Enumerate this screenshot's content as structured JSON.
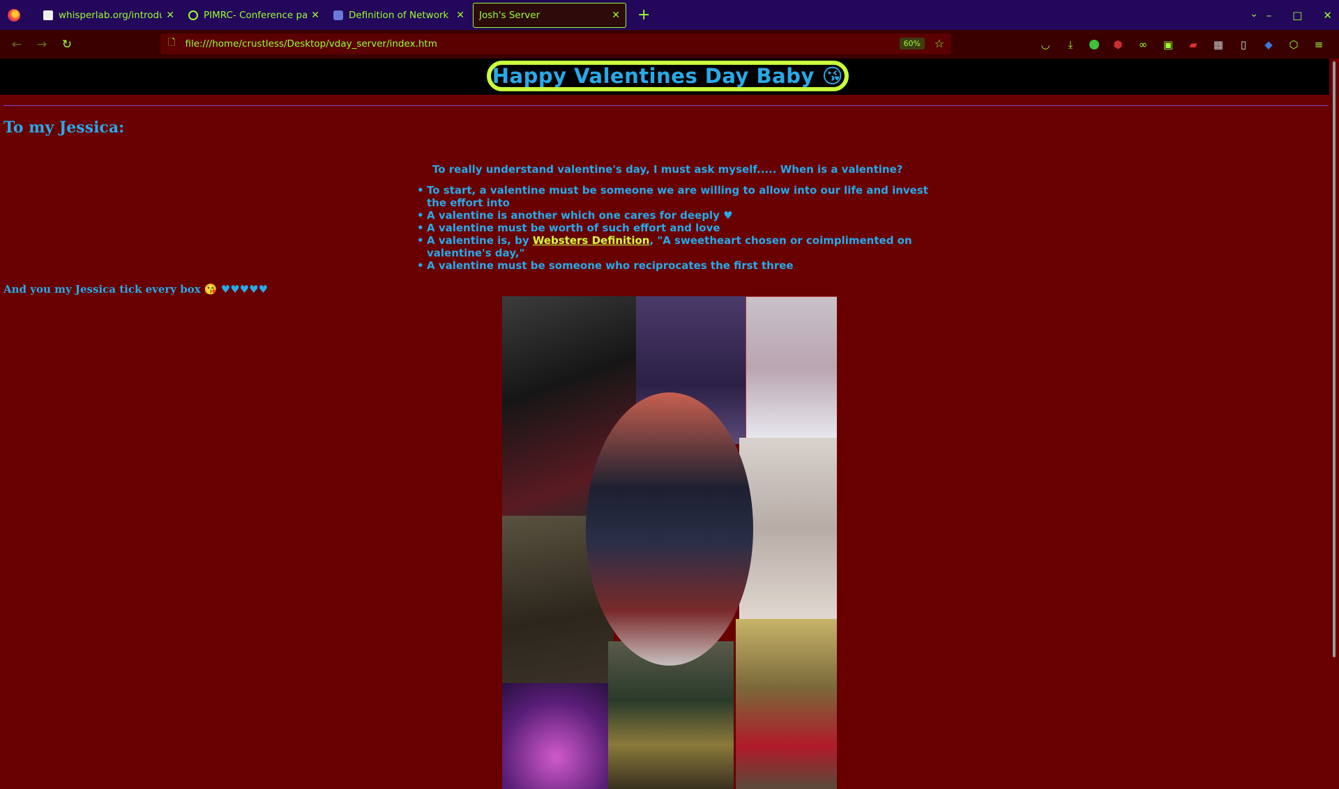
{
  "browser": {
    "tabs": [
      {
        "title": "whisperlab.org/introductio",
        "icon": "page-favicon",
        "active": false
      },
      {
        "title": "PIMRC- Conference paper - ",
        "icon": "conference-favicon",
        "active": false
      },
      {
        "title": "Definition of Network Units",
        "icon": "globe-favicon",
        "active": false
      },
      {
        "title": "Josh's Server",
        "icon": "none",
        "active": true
      }
    ],
    "url": "file:///home/crustless/Desktop/vday_server/index.htm",
    "zoom": "60%",
    "theme": {
      "chrome": "#23075a",
      "accent": "#9cff36",
      "nav": "#3a0000"
    }
  },
  "page": {
    "banner": "Happy Valentines Day Baby 😘",
    "salutation": "To my Jessica:",
    "question": "To really understand valentine's day, I must ask myself..... When is a valentine?",
    "reasons": [
      "To start, a valentine must be someone we are willing to allow into our life and invest the effort into",
      "A valentine is another which one cares for deeply ♥",
      "A valentine must be worth of such effort and love",
      {
        "before": "A valentine is, by ",
        "link": "Websters Definition",
        "after": ", \"A sweetheart chosen or coimplimented on valentine's day,\""
      },
      "A valentine must be someone who reciprocates the first three"
    ],
    "closing": "And you my Jessica tick every box 😘 ♥♥♥♥♥",
    "colors": {
      "background": "#680000",
      "text": "#29a9e8",
      "banner_border": "#c9ff3c",
      "link": "#d4ff3c"
    }
  }
}
